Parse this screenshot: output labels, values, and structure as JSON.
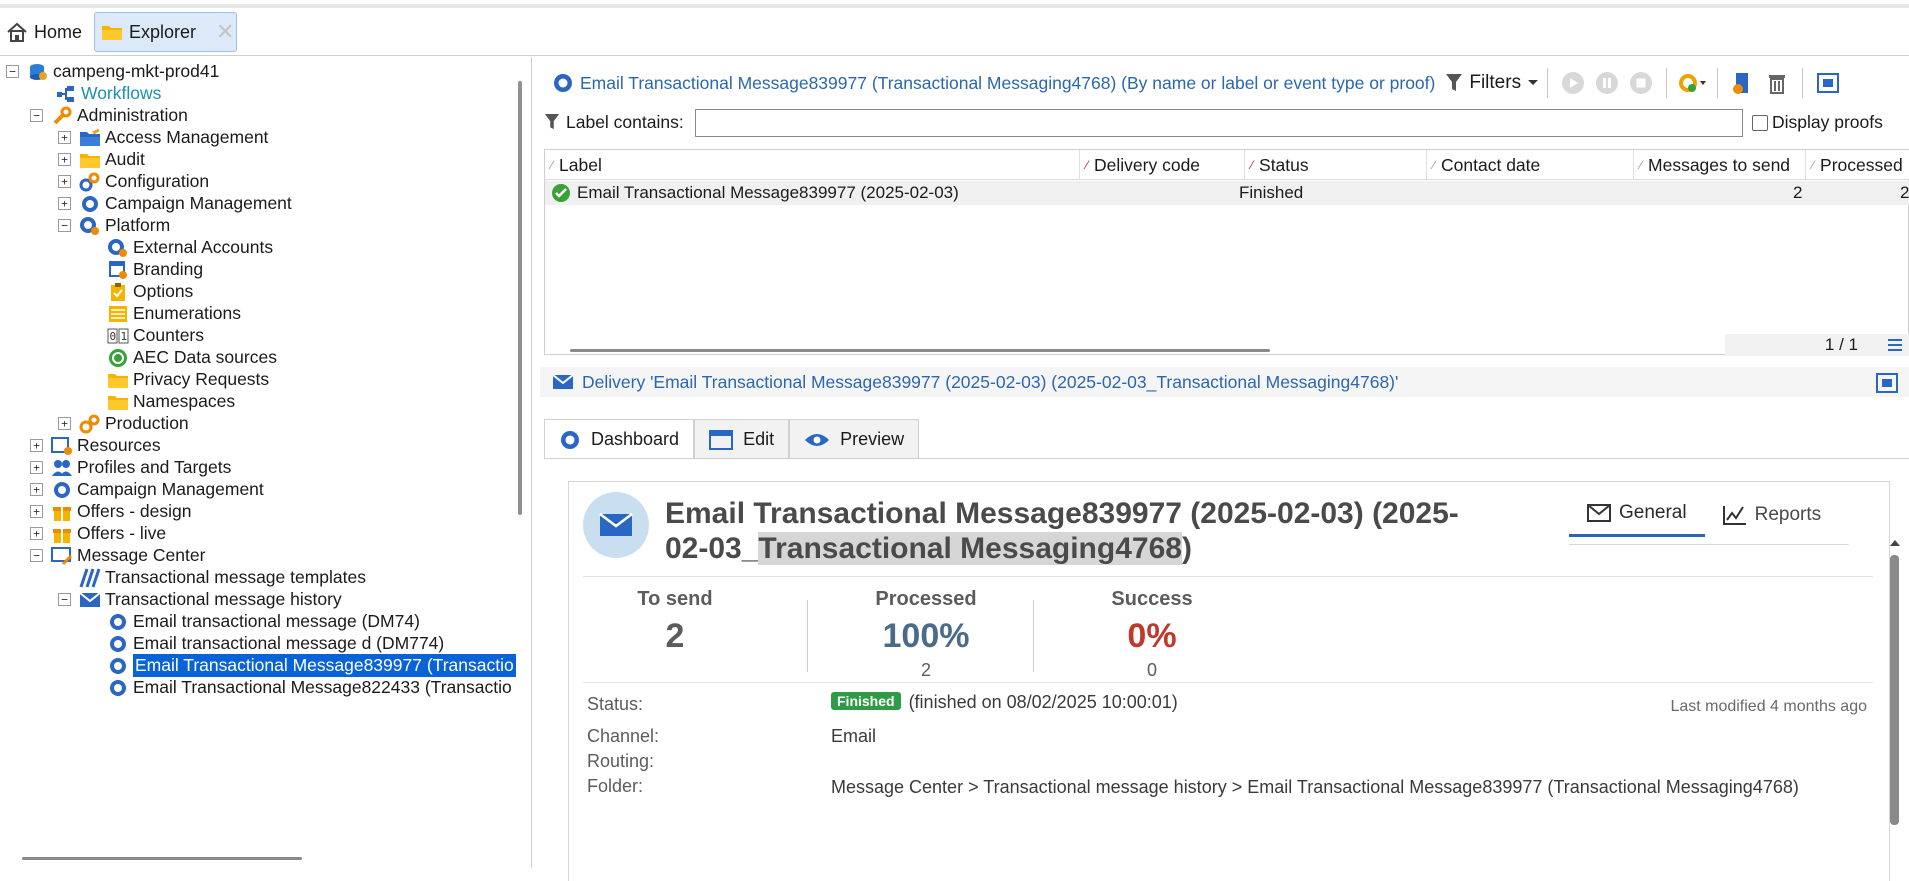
{
  "tabs": [
    {
      "label": "Home"
    },
    {
      "label": "Explorer"
    }
  ],
  "tree": {
    "root": "campeng-mkt-prod41",
    "workflows": "Workflows",
    "administration": "Administration",
    "access_management": "Access Management",
    "audit": "Audit",
    "configuration": "Configuration",
    "campaign_management": "Campaign Management",
    "platform": "Platform",
    "external_accounts": "External Accounts",
    "branding": "Branding",
    "options": "Options",
    "enumerations": "Enumerations",
    "counters": "Counters",
    "aec_data_sources": "AEC Data sources",
    "privacy_requests": "Privacy Requests",
    "namespaces": "Namespaces",
    "production": "Production",
    "resources": "Resources",
    "profiles_targets": "Profiles and Targets",
    "campaign_management2": "Campaign Management",
    "offers_design": "Offers - design",
    "offers_live": "Offers - live",
    "message_center": "Message Center",
    "tm_templates": "Transactional message templates",
    "tm_history": "Transactional message history",
    "item1": "Email transactional message (DM74)",
    "item2": "Email transactional message d (DM774)",
    "item3": "Email Transactional Message839977 (Transactio",
    "item4": "Email Transactional Message822433 (Transactio"
  },
  "list": {
    "title": "Email Transactional Message839977 (Transactional Messaging4768) (By name or label or event type or proof)",
    "filters": "Filters",
    "label_contains": "Label contains:",
    "label_value": "",
    "display_proofs": "Display proofs",
    "columns": [
      "Label",
      "Delivery code",
      "Status",
      "Contact date",
      "Messages to send",
      "Processed"
    ],
    "rows": [
      {
        "label": "Email Transactional Message839977 (2025-02-03)",
        "delivery_code": "",
        "status": "Finished",
        "contact_date": "",
        "to_send": "2",
        "processed": "2"
      }
    ],
    "pager": "1 / 1"
  },
  "detail": {
    "header": "Delivery 'Email Transactional Message839977 (2025-02-03) (2025-02-03_Transactional Messaging4768)'",
    "tabs": [
      "Dashboard",
      "Edit",
      "Preview"
    ],
    "title_part1": "Email Transactional Message839977 (2025-02-03) (2025-02-03_",
    "title_highlight": "Transactional Messaging4768",
    "title_part2": ")",
    "card_tabs": [
      "General",
      "Reports"
    ],
    "kpis": [
      {
        "label": "To send",
        "value": "2",
        "sub": ""
      },
      {
        "label": "Processed",
        "value": "100%",
        "sub": "2"
      },
      {
        "label": "Success",
        "value": "0%",
        "sub": "0"
      }
    ],
    "status_label": "Status:",
    "status_badge": "Finished",
    "status_text": "(finished on 08/02/2025 10:00:01)",
    "last_modified": "Last modified 4 months ago",
    "channel_label": "Channel:",
    "channel_value": "Email",
    "routing_label": "Routing:",
    "routing_value": "",
    "folder_label": "Folder:",
    "folder_value": "Message Center > Transactional message history > Email Transactional Message839977 (Transactional Messaging4768)"
  },
  "colors": {
    "link_blue": "#2b67b1",
    "selected": "#0a63d6",
    "success_red": "#c0392b",
    "processed_blue": "#4a6b8a",
    "finished_green": "#2f9b46"
  }
}
